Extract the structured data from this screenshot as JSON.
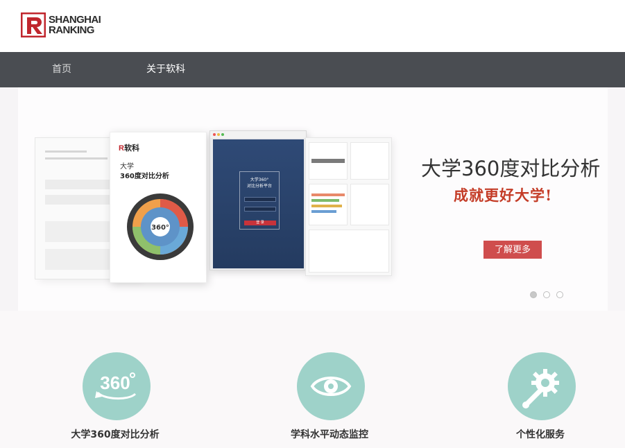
{
  "brand": {
    "line1": "SHANGHAI",
    "line2": "RANKING",
    "mark_color": "#c0262d"
  },
  "nav": {
    "items": [
      {
        "label": "首页"
      },
      {
        "label": "关于软科"
      }
    ]
  },
  "banner": {
    "headline": "大学360度对比分析",
    "slogan": "成就更好大学!",
    "cta_label": "了解更多",
    "slides": 3,
    "active_slide": 1,
    "mockup": {
      "brochure_logo_letter": "R",
      "brochure_logo_text": "软科",
      "brochure_title_1": "大学",
      "brochure_title_2": "360度对比分析",
      "wheel_label": "360°",
      "screen_title_1": "大学360°",
      "screen_title_2": "对比分析平台",
      "screen_button": "登 录"
    }
  },
  "features": [
    {
      "label": "大学360度对比分析",
      "icon": "360-icon"
    },
    {
      "label": "学科水平动态监控",
      "icon": "eye-icon"
    },
    {
      "label": "个性化服务",
      "icon": "gear-wrench-icon"
    }
  ],
  "colors": {
    "nav_bg": "#4a4d52",
    "accent_red": "#cf4d4d",
    "slogan_red": "#c43c27",
    "icon_teal": "#9ed2c9"
  }
}
